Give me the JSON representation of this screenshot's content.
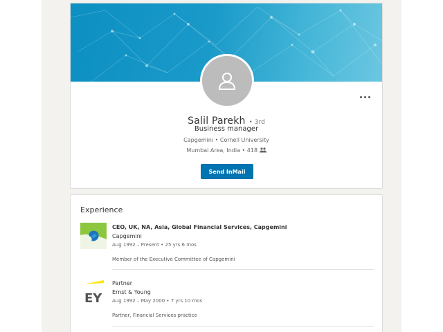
{
  "profile": {
    "name": "Salil Parekh",
    "degree": "• 3rd",
    "headline": "Business manager",
    "education": "Capgemini • Cornell University",
    "location": "Mumbai Area, India • 418",
    "send_button": "Send InMail"
  },
  "experience": {
    "title": "Experience",
    "items": [
      {
        "title": "CEO, UK, NA, Asia, Global Financial Services, Capgemini",
        "company": "Capgemini",
        "dates": "Aug 1992 – Present  •  25 yrs 6 mos",
        "description": "Member of the Executive Committee of Capgemini",
        "logo": "capgemini-logo"
      },
      {
        "title": "Partner",
        "company": "Ernst & Young",
        "dates": "Aug 1992 – May 2000  •  7 yrs 10 mos",
        "description": "Partner, Financial Services practice",
        "logo_text": "EY",
        "logo": "ey-logo"
      }
    ]
  },
  "colors": {
    "accent": "#0073b1",
    "banner": "#1a9ac9",
    "capgemini_green": "#8dc63f",
    "ey_yellow": "#ffe600"
  },
  "icons": [
    "person-placeholder-icon",
    "more-options-icon",
    "connections-icon"
  ]
}
